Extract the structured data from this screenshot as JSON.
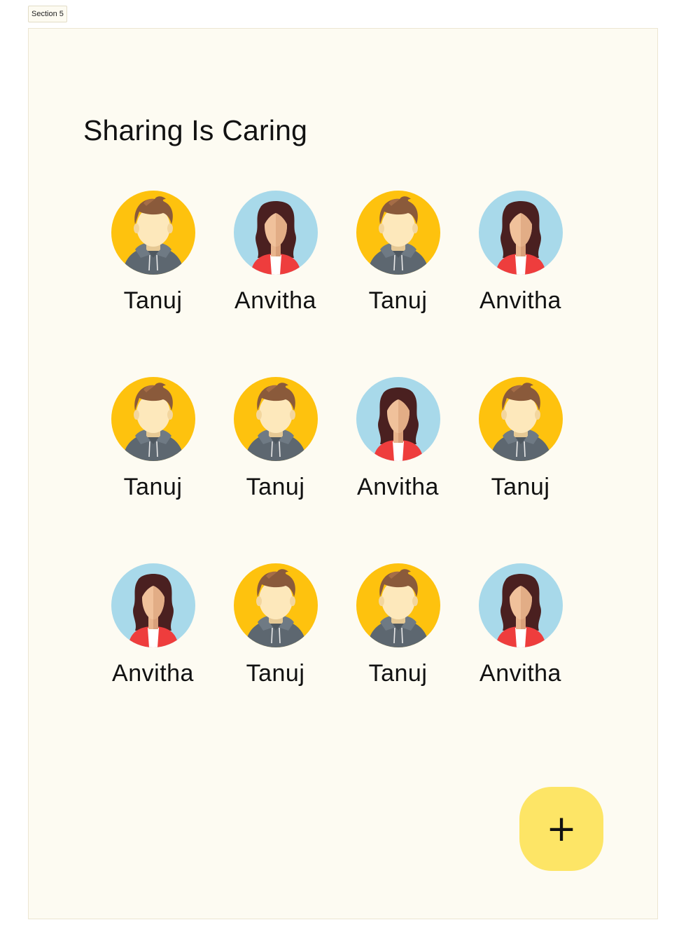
{
  "section_label": "Section 5",
  "page": {
    "title": "Sharing Is Caring"
  },
  "members": [
    {
      "name": "Tanuj",
      "avatar": "male-avatar-icon"
    },
    {
      "name": "Anvitha",
      "avatar": "female-avatar-icon"
    },
    {
      "name": "Tanuj",
      "avatar": "male-avatar-icon"
    },
    {
      "name": "Anvitha",
      "avatar": "female-avatar-icon"
    },
    {
      "name": "Tanuj",
      "avatar": "male-avatar-icon"
    },
    {
      "name": "Tanuj",
      "avatar": "male-avatar-icon"
    },
    {
      "name": "Anvitha",
      "avatar": "female-avatar-icon"
    },
    {
      "name": "Tanuj",
      "avatar": "male-avatar-icon"
    },
    {
      "name": "Anvitha",
      "avatar": "female-avatar-icon"
    },
    {
      "name": "Tanuj",
      "avatar": "male-avatar-icon"
    },
    {
      "name": "Tanuj",
      "avatar": "male-avatar-icon"
    },
    {
      "name": "Anvitha",
      "avatar": "female-avatar-icon"
    }
  ],
  "fab": {
    "label": "+",
    "icon": "plus-icon"
  },
  "colors": {
    "background": "#fdfbf2",
    "male_avatar_bg": "#fec20e",
    "female_avatar_bg": "#a8d9ea",
    "fab_bg": "#fde566"
  }
}
